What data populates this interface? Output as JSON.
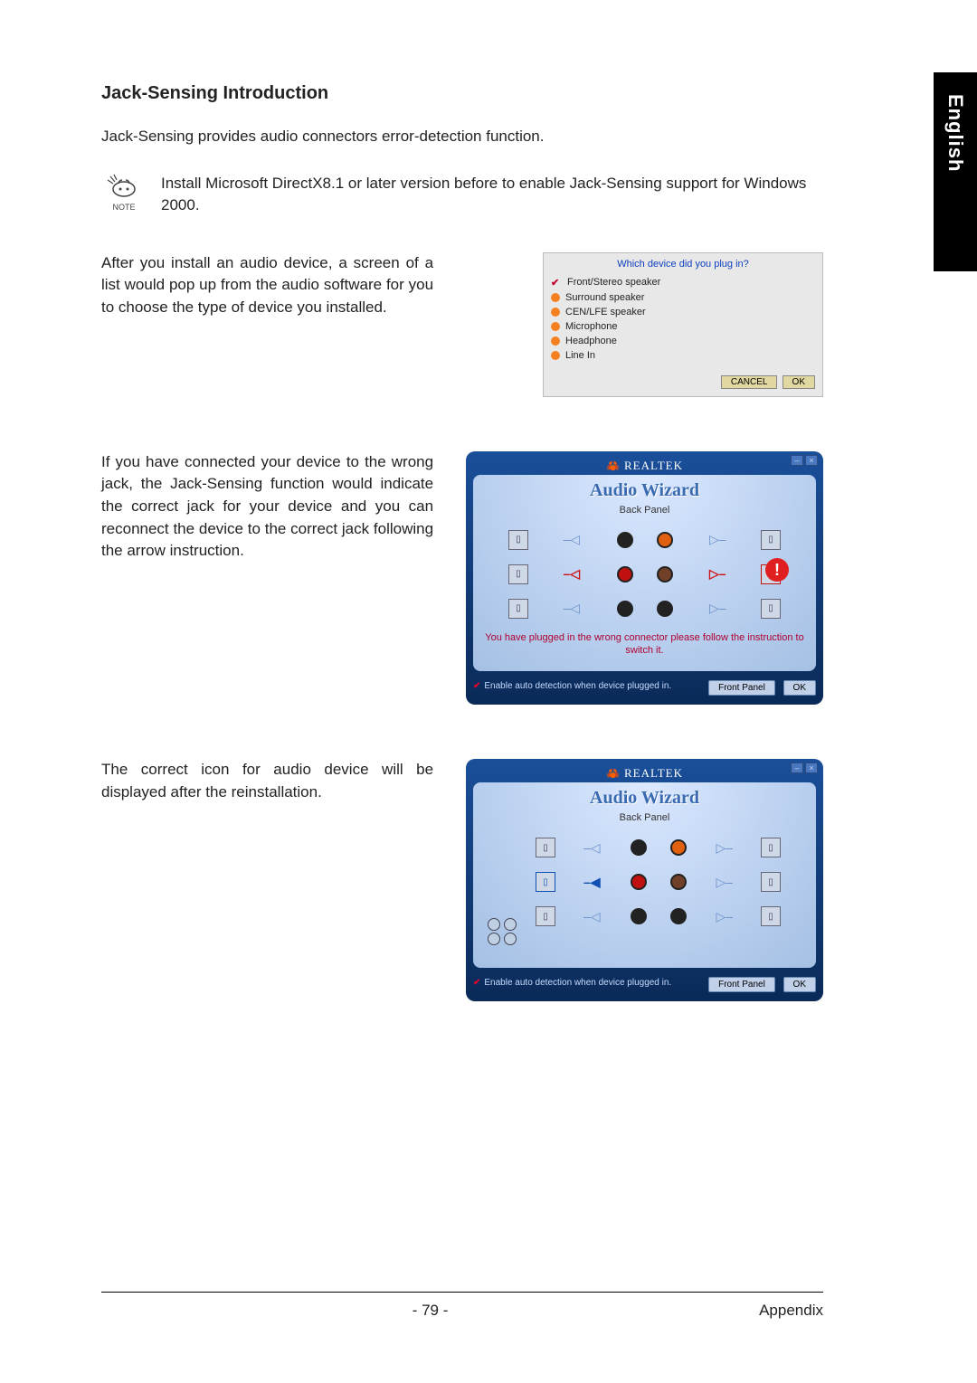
{
  "sidebar": {
    "lang": "English"
  },
  "heading": "Jack-Sensing Introduction",
  "intro": "Jack-Sensing provides audio connectors error-detection function.",
  "note": {
    "label": "NOTE",
    "text": "Install Microsoft DirectX8.1 or later version before to enable Jack-Sensing support for Windows 2000."
  },
  "section1": {
    "text": "After you install an audio device, a screen of a list would pop up from the audio software for you to choose the type of device you installed.",
    "popup": {
      "question": "Which device did you plug in?",
      "options": [
        {
          "label": "Front/Stereo speaker",
          "selected": true
        },
        {
          "label": "Surround speaker",
          "selected": false
        },
        {
          "label": "CEN/LFE speaker",
          "selected": false
        },
        {
          "label": "Microphone",
          "selected": false
        },
        {
          "label": "Headphone",
          "selected": false
        },
        {
          "label": "Line In",
          "selected": false
        }
      ],
      "cancel": "CANCEL",
      "ok": "OK"
    }
  },
  "section2": {
    "text": "If you have connected your device to the wrong jack, the Jack-Sensing function would indicate the correct jack for your device and you can reconnect the device to the correct jack following the arrow instruction.",
    "wizard": {
      "brand": "REALTEK",
      "title": "Audio Wizard",
      "subtitle": "Back Panel",
      "warning": "You have plugged in the wrong connector please follow the instruction to switch it.",
      "checkbox": "Enable auto detection when device plugged in.",
      "btn_front": "Front Panel",
      "btn_ok": "OK"
    }
  },
  "section3": {
    "text": "The correct icon for audio device will be displayed after the reinstallation.",
    "wizard": {
      "brand": "REALTEK",
      "title": "Audio Wizard",
      "subtitle": "Back Panel",
      "checkbox": "Enable auto detection when device plugged in.",
      "btn_front": "Front Panel",
      "btn_ok": "OK"
    }
  },
  "footer": {
    "page": "- 79 -",
    "section": "Appendix"
  }
}
